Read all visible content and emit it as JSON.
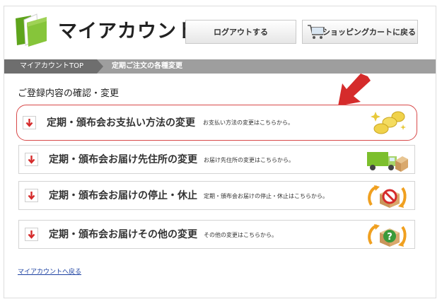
{
  "header": {
    "title": "マイアカウント",
    "logout_label": "ログアウトする",
    "cart_label": "ショッピングカートに戻る"
  },
  "breadcrumb": {
    "items": [
      "マイアカウントTOP",
      "定期ご注文の各種変更"
    ]
  },
  "section_title": "ご登録内容の確認・変更",
  "options": [
    {
      "label": "定期・頒布会お支払い方法の変更",
      "desc": "お支払い方法の変更はこちらから。",
      "icon": "coins-icon"
    },
    {
      "label": "定期・頒布会お届け先住所の変更",
      "desc": "お届け先住所の変更はこちらから。",
      "icon": "delivery-truck-icon"
    },
    {
      "label": "定期・頒布会お届けの停止・休止",
      "desc": "定期・頒布会お届けの停止・休止はこちらから。",
      "icon": "box-prohibited-icon"
    },
    {
      "label": "定期・頒布会お届けその他の変更",
      "desc": "その他の変更はこちらから。",
      "icon": "box-question-icon"
    }
  ],
  "back_link": "マイアカウントへ戻る",
  "colors": {
    "accent_red": "#d52b2b",
    "logo_green": "#7bbf2a",
    "breadcrumb_dark": "#6e6e6e",
    "breadcrumb_light": "#9e9e9e",
    "link_blue": "#1a3fa0"
  }
}
